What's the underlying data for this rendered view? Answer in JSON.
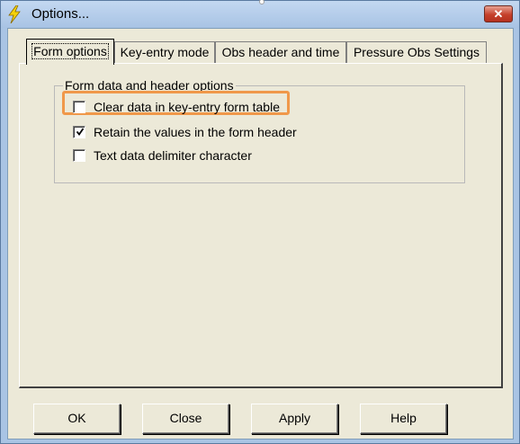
{
  "window": {
    "title": "Options...",
    "close_label": "✕"
  },
  "tabs": [
    {
      "label": "Form options",
      "active": true
    },
    {
      "label": "Key-entry mode",
      "active": false
    },
    {
      "label": "Obs header and time",
      "active": false
    },
    {
      "label": "Pressure Obs Settings",
      "active": false
    }
  ],
  "group": {
    "label": "Form data and header options",
    "options": [
      {
        "label": "Clear data in key-entry form table",
        "checked": false,
        "highlighted": true
      },
      {
        "label": "Retain the values in the form header",
        "checked": true,
        "highlighted": false
      },
      {
        "label": "Text data delimiter character",
        "checked": false,
        "highlighted": false
      }
    ]
  },
  "buttons": {
    "ok": "OK",
    "close": "Close",
    "apply": "Apply",
    "help": "Help"
  },
  "colors": {
    "highlight_border": "#f0984a",
    "titlebar": "#a8c3e4",
    "close_button": "#c5402b",
    "dialog_face": "#ece9d8"
  },
  "icons": {
    "app": "lightning-bolt-icon",
    "close": "close-icon",
    "check": "check-mark-icon"
  }
}
